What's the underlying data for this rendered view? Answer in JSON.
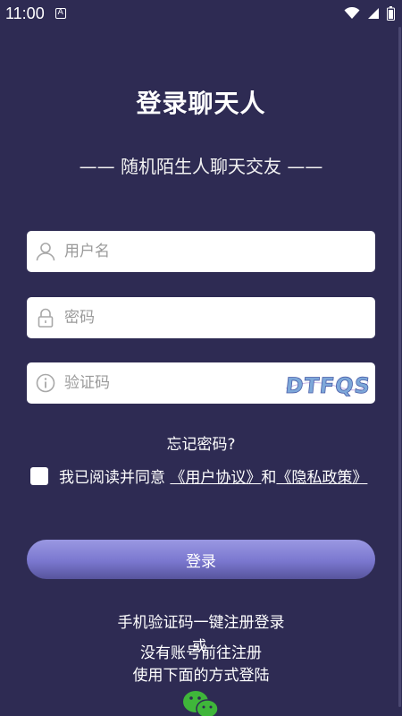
{
  "status_bar": {
    "time": "11:00",
    "notif_glyph": "A"
  },
  "title": "登录聊天人",
  "subtitle": "—— 随机陌生人聊天交友 ——",
  "form": {
    "username_placeholder": "用户名",
    "password_placeholder": "密码",
    "captcha_placeholder": "验证码",
    "captcha_text": "DTFQS"
  },
  "forgot_password": "忘记密码?",
  "agreement": {
    "prefix": "我已阅读并同意 ",
    "user_agreement": "《用户协议》",
    "and": "和",
    "privacy_policy": "《隐私政策》"
  },
  "login_button": "登录",
  "sms_login": "手机验证码一键注册登录",
  "or": "或",
  "register": "没有账号前往注册",
  "other_login": "使用下面的方式登陆",
  "colors": {
    "background": "#2e2b53",
    "button_top": "#9a98e2",
    "button_bottom": "#57549c",
    "wechat": "#3fb63a"
  },
  "icons": [
    "user-icon",
    "lock-icon",
    "info-icon",
    "wechat-icon",
    "wifi-icon",
    "signal-icon",
    "battery-icon"
  ]
}
